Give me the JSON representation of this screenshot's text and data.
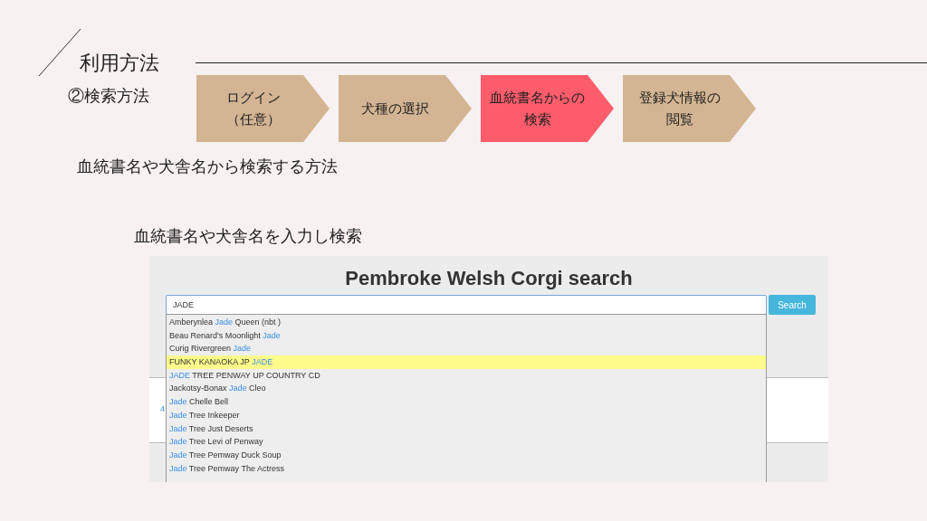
{
  "section_title": "利用方法",
  "subsection": "②検索方法",
  "steps": [
    {
      "label": "ログイン",
      "sub": "（任意）",
      "selected": false
    },
    {
      "label": "犬種の選択",
      "selected": false
    },
    {
      "label": "血統書名からの",
      "sub": "検索",
      "selected": true
    },
    {
      "label": "登録犬情報の",
      "sub": "閲覧",
      "selected": false
    }
  ],
  "description": "血統書名や犬舎名から検索する方法",
  "caption": "血統書名や犬舎名を入力し検索",
  "screenshot": {
    "title": "Pembroke Welsh Corgi search",
    "search_value": "JADE",
    "search_button": "Search",
    "page_link": "4",
    "suggestions": [
      {
        "before": "Amberynlea ",
        "match": "Jade",
        "after": " Queen (nbt )",
        "selected": false
      },
      {
        "before": "Beau Renard's Moonlight ",
        "match": "Jade",
        "selected": false
      },
      {
        "before": "Curig Rivergreen ",
        "match": "Jade",
        "selected": false
      },
      {
        "before": "FUNKY KANAOKA JP ",
        "match": "JADE",
        "selected": true
      },
      {
        "match": "JADE",
        "after": " TREE PENWAY UP COUNTRY CD",
        "selected": false
      },
      {
        "before": "Jackotsy-Bonax ",
        "match": "Jade",
        "after": " Cleo",
        "selected": false
      },
      {
        "match": "Jade",
        "after": " Chelle Bell",
        "selected": false
      },
      {
        "match": "Jade",
        "after": " Tree Inkeeper",
        "selected": false
      },
      {
        "match": "Jade",
        "after": " Tree Just Deserts",
        "selected": false
      },
      {
        "match": "Jade",
        "after": " Tree Levi of Penway",
        "selected": false
      },
      {
        "match": "Jade",
        "after": " Tree Pemway Duck Soup",
        "selected": false
      },
      {
        "match": "Jade",
        "after": " Tree Pemway The Actress",
        "selected": false
      }
    ]
  }
}
